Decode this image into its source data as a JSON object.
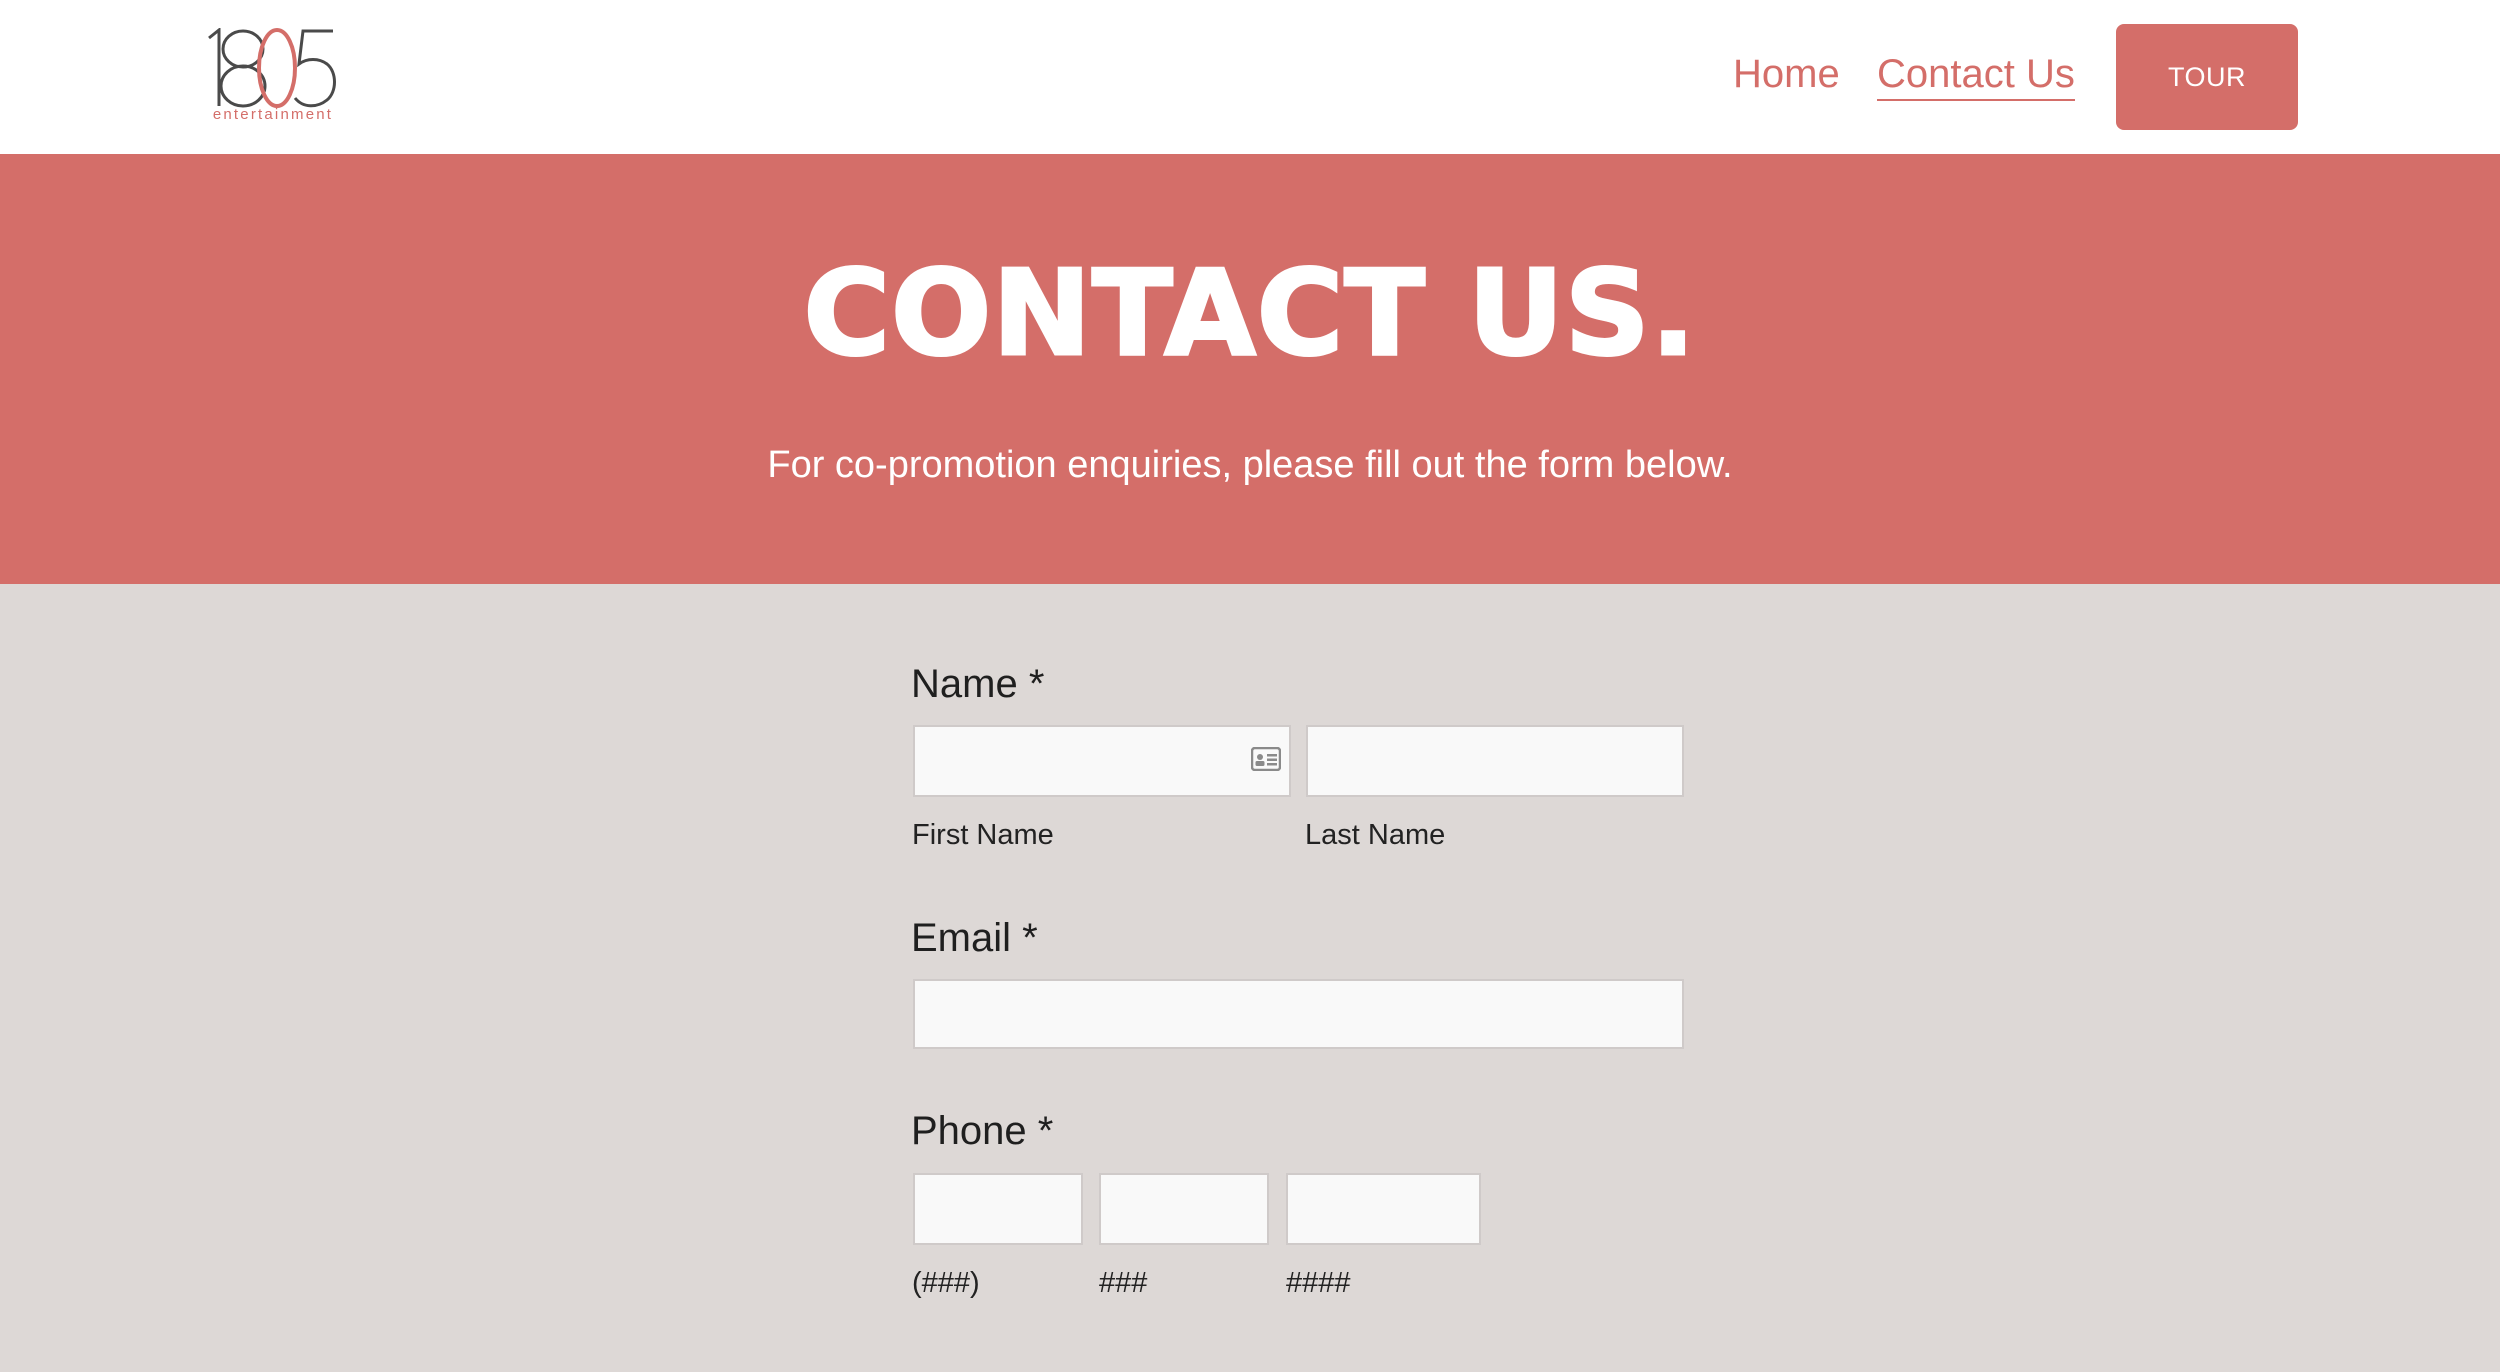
{
  "header": {
    "logo": {
      "digits": "1805",
      "subtitle": "entertainment",
      "icon": "1805-logo"
    },
    "nav": {
      "home": "Home",
      "contact": "Contact Us"
    },
    "tour_button": "TOUR"
  },
  "hero": {
    "title": "CONTACT US.",
    "subtitle": "For co-promotion enquiries, please fill out the form below."
  },
  "form": {
    "name": {
      "label": "Name *",
      "first_sub": "First Name",
      "last_sub": "Last Name",
      "first_value": "",
      "last_value": ""
    },
    "email": {
      "label": "Email *",
      "value": ""
    },
    "phone": {
      "label": "Phone *",
      "area_sub": "(###)",
      "prefix_sub": "###",
      "line_sub": "####"
    }
  },
  "colors": {
    "accent": "#d46e69",
    "background": "#ddd8d6",
    "field": "#f9f9f9",
    "logo_dark": "#4a4a4a"
  }
}
